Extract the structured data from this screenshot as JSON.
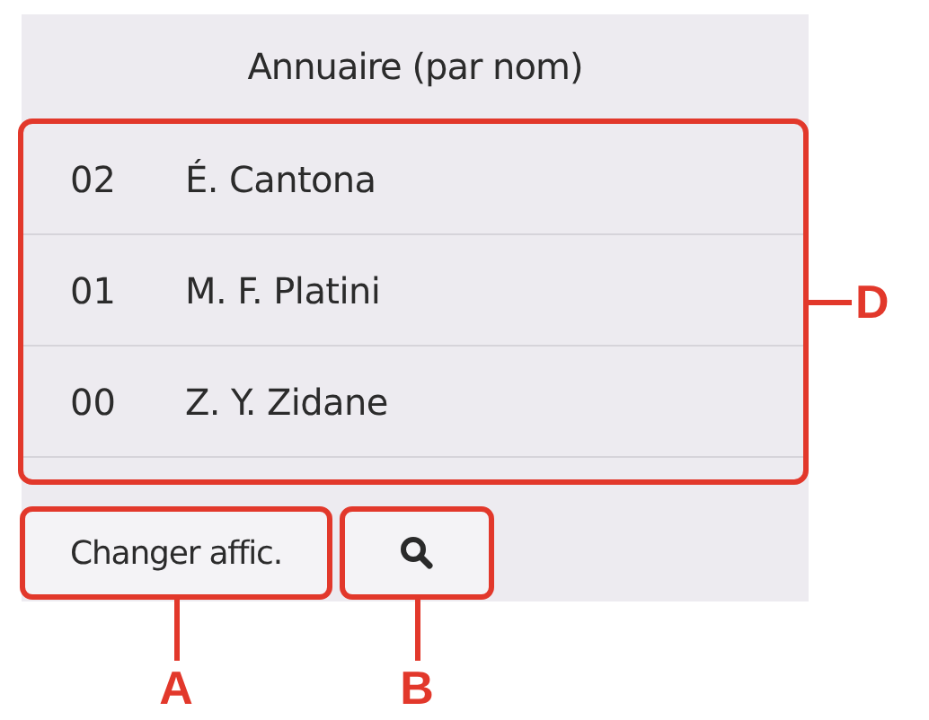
{
  "screen": {
    "title": "Annuaire (par nom)",
    "list": {
      "callout": "D",
      "entries": [
        {
          "number": "02",
          "name": "É. Cantona"
        },
        {
          "number": "01",
          "name": "M. F. Platini"
        },
        {
          "number": "00",
          "name": "Z. Y. Zidane"
        }
      ]
    },
    "buttons": [
      {
        "kind": "text",
        "label": "Changer affic.",
        "callout": "A"
      },
      {
        "kind": "search",
        "callout": "B"
      }
    ]
  }
}
